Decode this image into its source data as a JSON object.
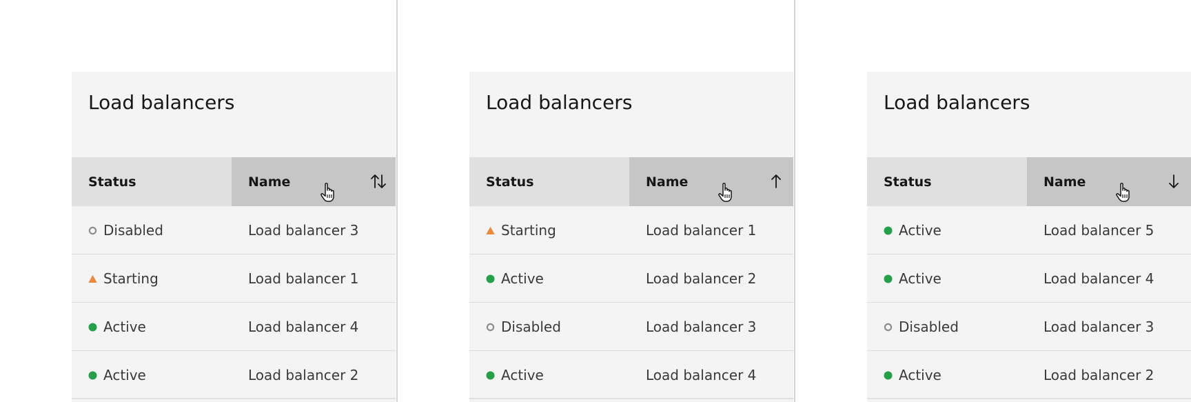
{
  "colors": {
    "active": "#24a148",
    "disabled": "#8d8d8d",
    "starting": "#f0883e",
    "panel_bg": "#f4f4f4",
    "header_bg": "#e0e0e0",
    "sorted_header_bg": "#c6c6c6"
  },
  "panels": [
    {
      "title": "Load balancers",
      "columns": {
        "status": "Status",
        "name": "Name"
      },
      "sort_state": "unsorted",
      "sort_icon": "arrows-vertical-icon",
      "rows": [
        {
          "status": "Disabled",
          "status_icon": "disabled-ring-icon",
          "name": "Load balancer 3"
        },
        {
          "status": "Starting",
          "status_icon": "warning-triangle-icon",
          "name": "Load balancer 1"
        },
        {
          "status": "Active",
          "status_icon": "active-dot-icon",
          "name": "Load balancer 4"
        },
        {
          "status": "Active",
          "status_icon": "active-dot-icon",
          "name": "Load balancer 2"
        }
      ]
    },
    {
      "title": "Load balancers",
      "columns": {
        "status": "Status",
        "name": "Name"
      },
      "sort_state": "ascending",
      "sort_icon": "arrow-up-icon",
      "rows": [
        {
          "status": "Starting",
          "status_icon": "warning-triangle-icon",
          "name": "Load balancer 1"
        },
        {
          "status": "Active",
          "status_icon": "active-dot-icon",
          "name": "Load balancer 2"
        },
        {
          "status": "Disabled",
          "status_icon": "disabled-ring-icon",
          "name": "Load balancer 3"
        },
        {
          "status": "Active",
          "status_icon": "active-dot-icon",
          "name": "Load balancer 4"
        }
      ]
    },
    {
      "title": "Load balancers",
      "columns": {
        "status": "Status",
        "name": "Name"
      },
      "sort_state": "descending",
      "sort_icon": "arrow-down-icon",
      "rows": [
        {
          "status": "Active",
          "status_icon": "active-dot-icon",
          "name": "Load balancer 5"
        },
        {
          "status": "Active",
          "status_icon": "active-dot-icon",
          "name": "Load balancer 4"
        },
        {
          "status": "Disabled",
          "status_icon": "disabled-ring-icon",
          "name": "Load balancer 3"
        },
        {
          "status": "Active",
          "status_icon": "active-dot-icon",
          "name": "Load balancer 2"
        }
      ]
    }
  ]
}
